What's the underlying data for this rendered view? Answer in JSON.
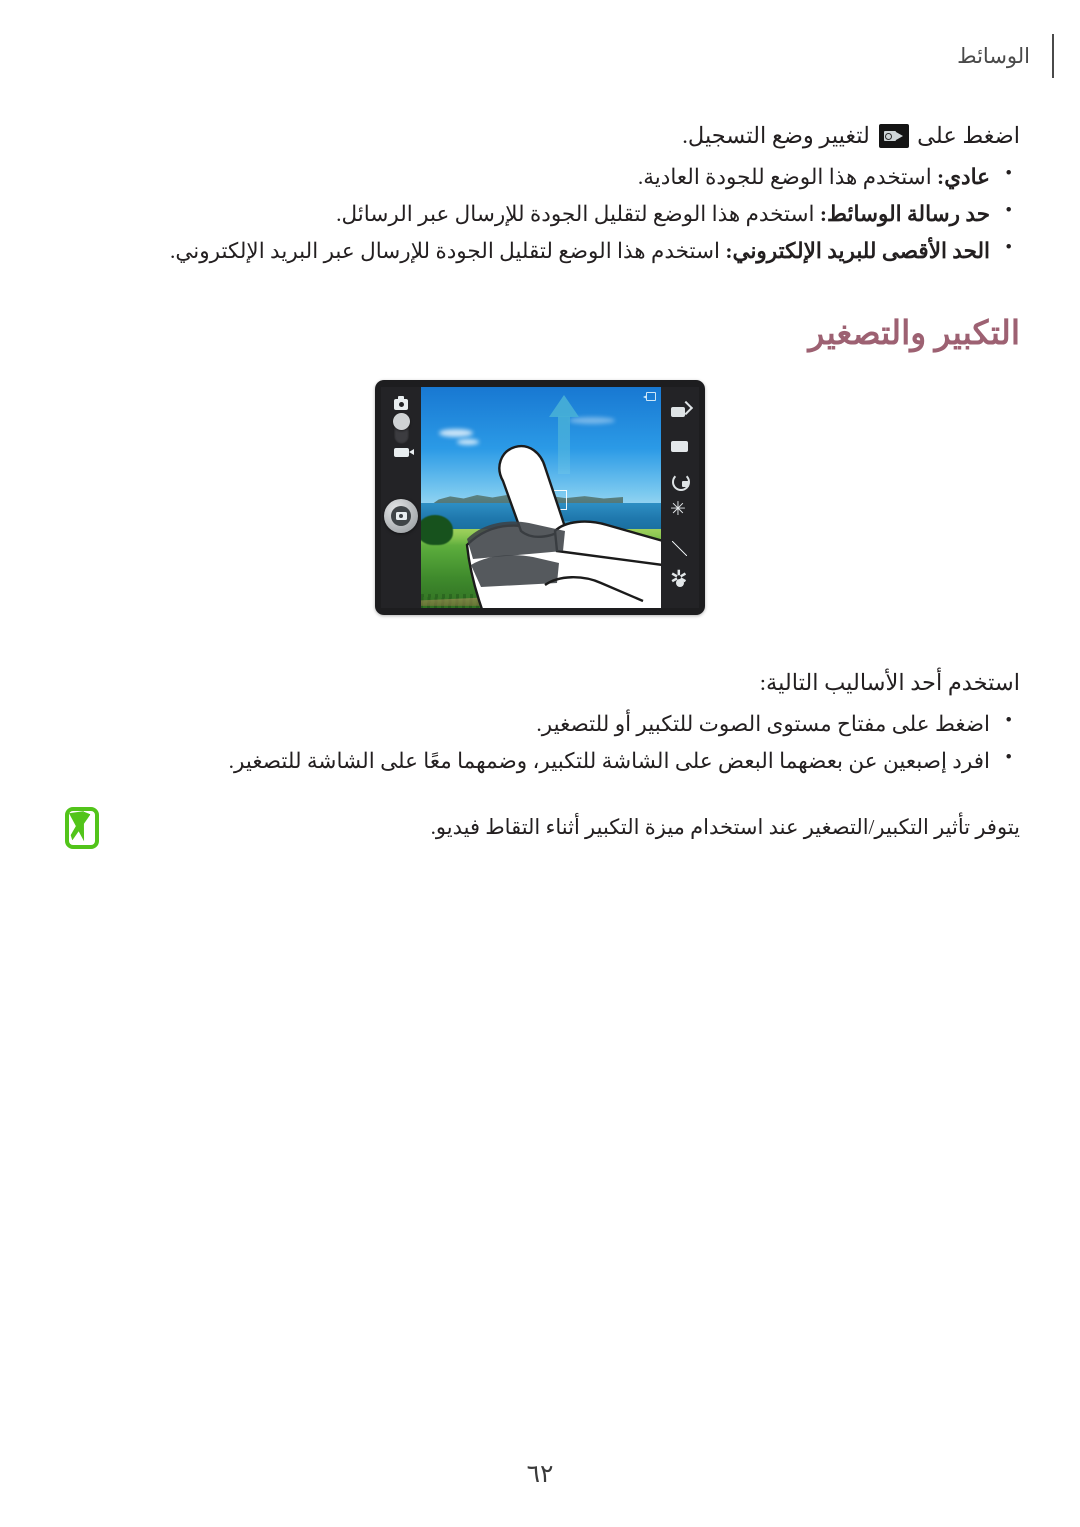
{
  "header": {
    "title": "الوسائط"
  },
  "intro": {
    "before_icon": "اضغط على",
    "icon_name": "camcorder-icon",
    "after_icon": "لتغيير وضع التسجيل."
  },
  "mode_list": [
    {
      "term": "عادي:",
      "description": "استخدم هذا الوضع للجودة العادية."
    },
    {
      "term": "حد رسالة الوسائط:",
      "description": "استخدم هذا الوضع لتقليل الجودة للإرسال عبر الرسائل."
    },
    {
      "term": "الحد الأقصى للبريد الإلكتروني:",
      "description": "استخدم هذا الوضع لتقليل الجودة للإرسال عبر البريد الإلكتروني."
    }
  ],
  "section": {
    "heading": "التكبير والتصغير",
    "heading_color": "#9d6172"
  },
  "figure": {
    "name": "camera-pinch-zoom-illustration",
    "device": "smartphone-camera-viewfinder",
    "toolbar_icons": [
      "camera-switch-icon",
      "shooting-mode-icon",
      "timer-off-icon",
      "effects-icon",
      "exposure-icon",
      "settings-gear-icon"
    ],
    "right_panel_icons": [
      "camera-mode-icon",
      "mode-toggle-slider",
      "video-mode-icon",
      "shutter-button"
    ],
    "gesture_arrows": [
      "arrow-up",
      "arrow-down"
    ],
    "scene": "coastal landscape with sky, sea, island and green field"
  },
  "methods": {
    "lead_in": "استخدم أحد الأساليب التالية:",
    "items": [
      "اضغط على مفتاح مستوى الصوت للتكبير أو للتصغير.",
      "افرد إصبعين عن بعضهما البعض على الشاشة للتكبير، وضمهما معًا على الشاشة للتصغير."
    ]
  },
  "note": {
    "icon_name": "note-pen-icon",
    "icon_color": "#52c41a",
    "text": "يتوفر تأثير التكبير/التصغير عند استخدام ميزة التكبير أثناء التقاط فيديو."
  },
  "footer": {
    "page_number": "٦٢"
  }
}
